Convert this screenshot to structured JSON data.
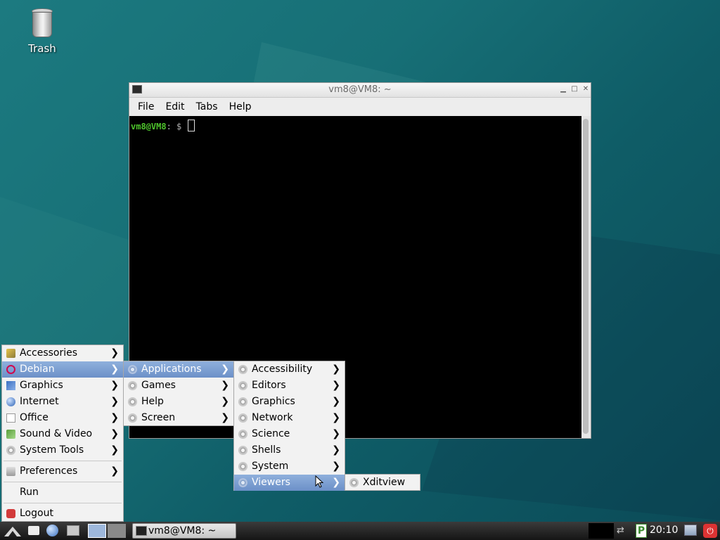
{
  "desktop": {
    "trash_label": "Trash"
  },
  "window": {
    "title": "vm8@VM8: ~",
    "menus": [
      "File",
      "Edit",
      "Tabs",
      "Help"
    ],
    "prompt_user": "vm8@VM8",
    "prompt_rest": ": $ "
  },
  "main_menu": {
    "items": [
      "Accessories",
      "Debian",
      "Graphics",
      "Internet",
      "Office",
      "Sound & Video",
      "System Tools"
    ],
    "preferences": "Preferences",
    "run": "Run",
    "logout": "Logout"
  },
  "debian_menu": {
    "items": [
      "Applications",
      "Games",
      "Help",
      "Screen"
    ]
  },
  "applications_menu": {
    "items": [
      "Accessibility",
      "Editors",
      "Graphics",
      "Network",
      "Science",
      "Shells",
      "System",
      "Viewers"
    ]
  },
  "viewers_menu": {
    "items": [
      "Xditview"
    ]
  },
  "taskbar": {
    "task_label": "vm8@VM8: ~",
    "clock": "20:10"
  },
  "colors": {
    "menu_selected": "#7c9ed0",
    "prompt_green": "#4ec42c"
  }
}
